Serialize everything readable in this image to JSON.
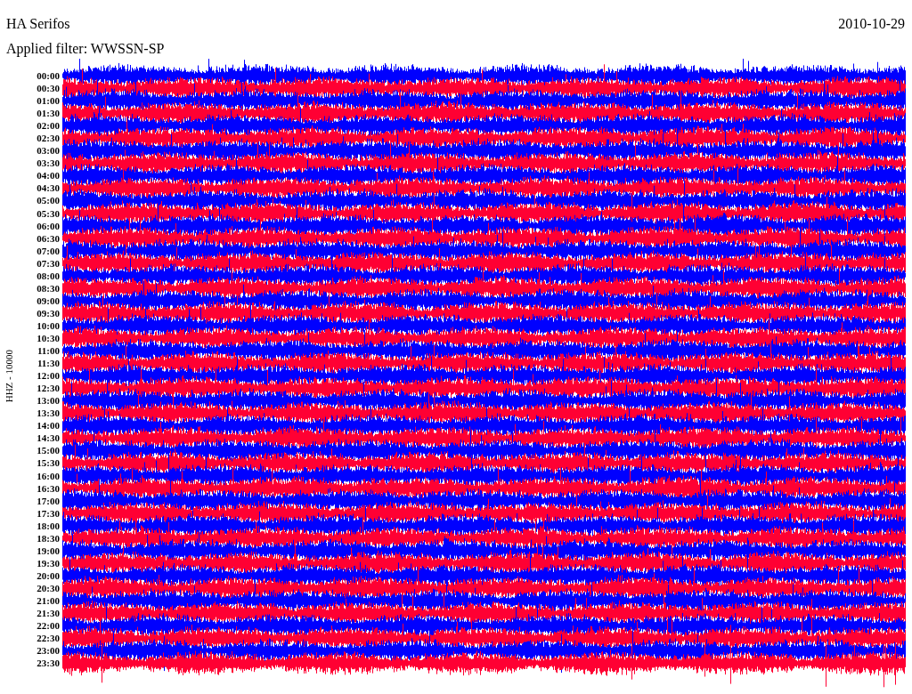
{
  "header": {
    "station": "HA Serifos",
    "date": "2010-10-29",
    "filter": "Applied filter: WWSSN-SP"
  },
  "y_label": "HHZ - 10000",
  "rows": [
    {
      "time": "00:00"
    },
    {
      "time": "00:30"
    },
    {
      "time": "01:00"
    },
    {
      "time": "01:30"
    },
    {
      "time": "02:00"
    },
    {
      "time": "02:30"
    },
    {
      "time": "03:00"
    },
    {
      "time": "03:30"
    },
    {
      "time": "04:00"
    },
    {
      "time": "04:30"
    },
    {
      "time": "05:00"
    },
    {
      "time": "05:30"
    },
    {
      "time": "06:00"
    },
    {
      "time": "06:30"
    },
    {
      "time": "07:00"
    },
    {
      "time": "07:30"
    },
    {
      "time": "08:00"
    },
    {
      "time": "08:30"
    },
    {
      "time": "09:00"
    },
    {
      "time": "09:30"
    },
    {
      "time": "10:00"
    },
    {
      "time": "10:30"
    },
    {
      "time": "11:00"
    },
    {
      "time": "11:30"
    },
    {
      "time": "12:00"
    },
    {
      "time": "12:30"
    },
    {
      "time": "13:00"
    },
    {
      "time": "13:30"
    },
    {
      "time": "14:00"
    },
    {
      "time": "14:30"
    },
    {
      "time": "15:00"
    },
    {
      "time": "15:30"
    },
    {
      "time": "16:00"
    },
    {
      "time": "16:30"
    },
    {
      "time": "17:00"
    },
    {
      "time": "17:30"
    },
    {
      "time": "18:00"
    },
    {
      "time": "18:30"
    },
    {
      "time": "19:00"
    },
    {
      "time": "19:30"
    },
    {
      "time": "20:00"
    },
    {
      "time": "20:30"
    },
    {
      "time": "21:00"
    },
    {
      "time": "21:30"
    },
    {
      "time": "22:00"
    },
    {
      "time": "22:30"
    },
    {
      "time": "23:00"
    },
    {
      "time": "23:30"
    }
  ]
}
